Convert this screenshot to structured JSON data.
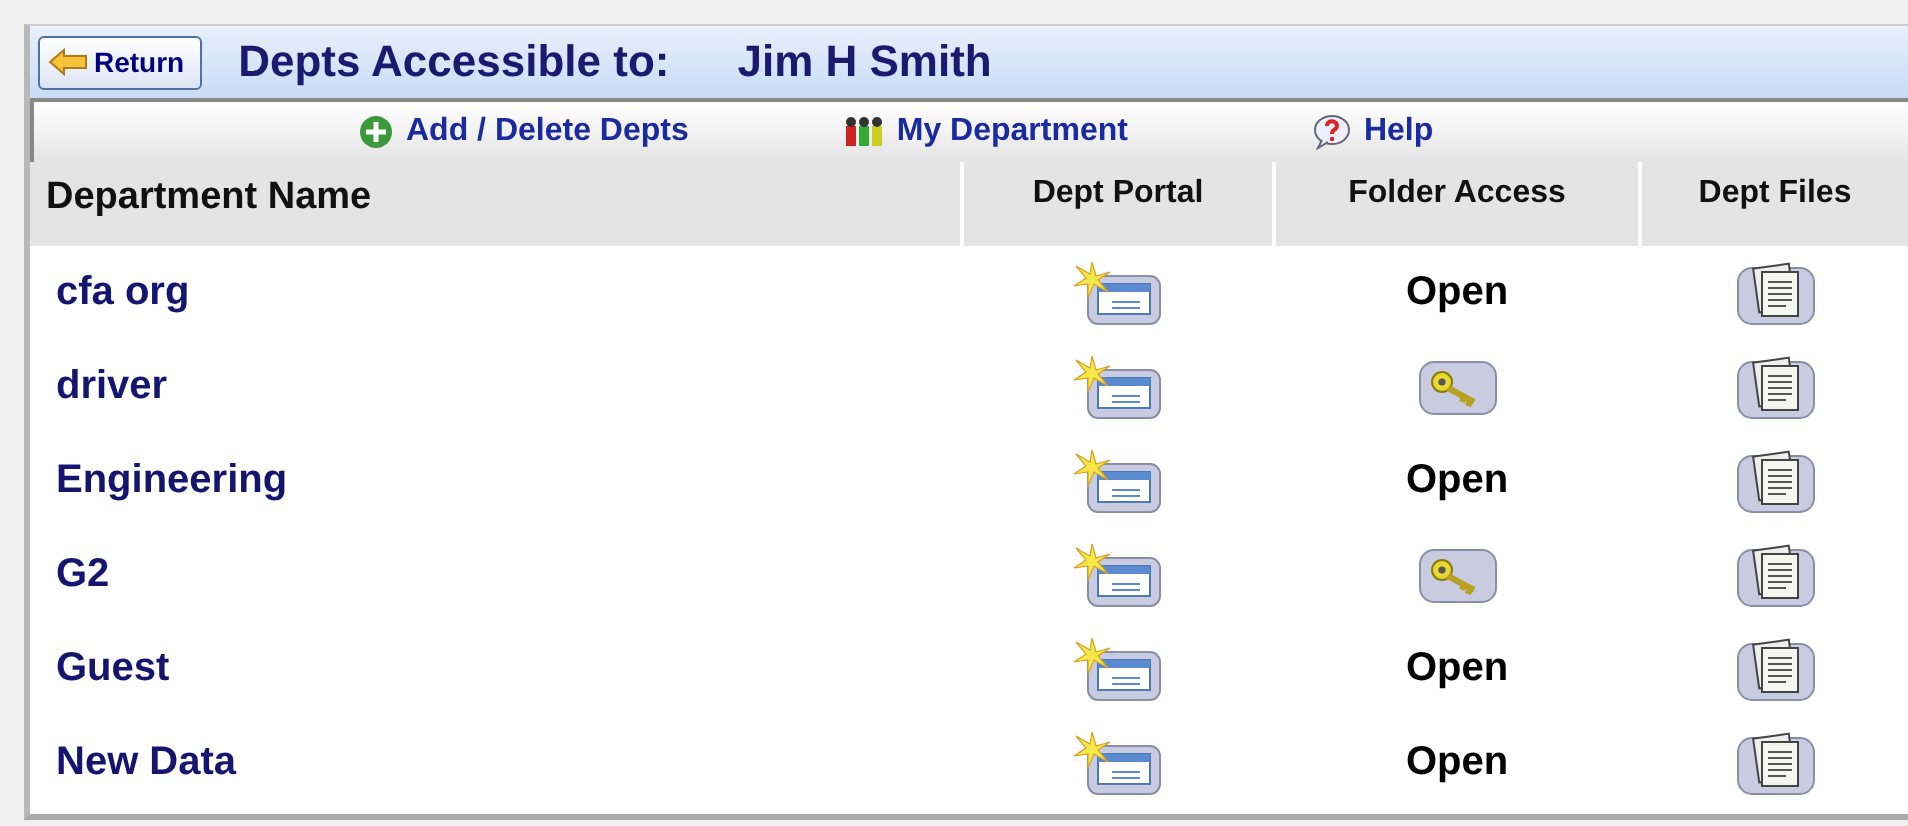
{
  "header": {
    "return_button": "Return",
    "title": "Depts Accessible to:",
    "user": "Jim H Smith"
  },
  "toolbar": [
    "Add / Delete Depts",
    "My Department",
    "Help"
  ],
  "table": {
    "columns": [
      "Department Name",
      "Dept  Portal",
      "Folder Access",
      "Dept Files"
    ],
    "rows": [
      {
        "name": "cfa org",
        "folder_access": {
          "kind": "text",
          "text": "Open"
        }
      },
      {
        "name": "driver",
        "folder_access": {
          "kind": "key"
        }
      },
      {
        "name": "Engineering",
        "folder_access": {
          "kind": "text",
          "text": "Open"
        }
      },
      {
        "name": "G2",
        "folder_access": {
          "kind": "key"
        }
      },
      {
        "name": "Guest",
        "folder_access": {
          "kind": "text",
          "text": "Open"
        }
      },
      {
        "name": "New Data",
        "folder_access": {
          "kind": "text",
          "text": "Open"
        }
      }
    ]
  }
}
